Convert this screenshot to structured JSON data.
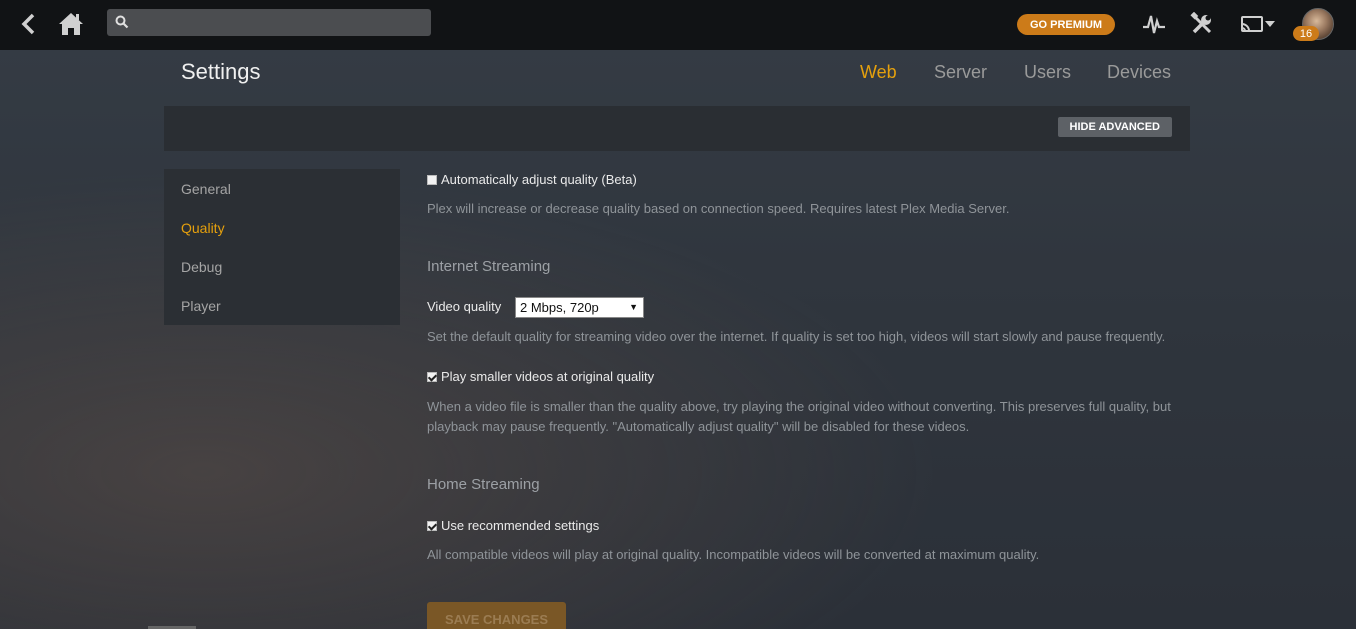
{
  "topbar": {
    "search_placeholder": "",
    "premium_label": "GO PREMIUM",
    "notification_count": "16",
    "icons": [
      "back-icon",
      "home-icon",
      "search-icon",
      "activity-icon",
      "tools-icon",
      "cast-icon",
      "avatar"
    ]
  },
  "header": {
    "title": "Settings",
    "tabs": [
      {
        "label": "Web",
        "active": true
      },
      {
        "label": "Server",
        "active": false
      },
      {
        "label": "Users",
        "active": false
      },
      {
        "label": "Devices",
        "active": false
      }
    ],
    "hide_advanced_label": "HIDE ADVANCED"
  },
  "sidebar": {
    "items": [
      {
        "label": "General",
        "active": false
      },
      {
        "label": "Quality",
        "active": true
      },
      {
        "label": "Debug",
        "active": false
      },
      {
        "label": "Player",
        "active": false
      }
    ]
  },
  "main": {
    "auto_adjust": {
      "label": "Automatically adjust quality (Beta)",
      "checked": false,
      "help": "Plex will increase or decrease quality based on connection speed. Requires latest Plex Media Server."
    },
    "internet_streaming": {
      "title": "Internet Streaming",
      "video_quality_label": "Video quality",
      "video_quality_value": "2 Mbps, 720p",
      "video_quality_help": "Set the default quality for streaming video over the internet. If quality is set too high, videos will start slowly and pause frequently.",
      "smaller_videos_label": "Play smaller videos at original quality",
      "smaller_videos_checked": true,
      "smaller_videos_help_line1": "When a video file is smaller than the quality above, try playing the original video without converting. This preserves full quality, but",
      "smaller_videos_help_line2": "playback may pause frequently. \"Automatically adjust quality\" will be disabled for these videos."
    },
    "home_streaming": {
      "title": "Home Streaming",
      "recommended_label": "Use recommended settings",
      "recommended_checked": true,
      "recommended_help": "All compatible videos will play at original quality. Incompatible videos will be converted at maximum quality."
    },
    "save_label": "SAVE CHANGES"
  },
  "colors": {
    "accent": "#e5a00d",
    "premium": "#cc7b19",
    "topbar": "#111315"
  }
}
